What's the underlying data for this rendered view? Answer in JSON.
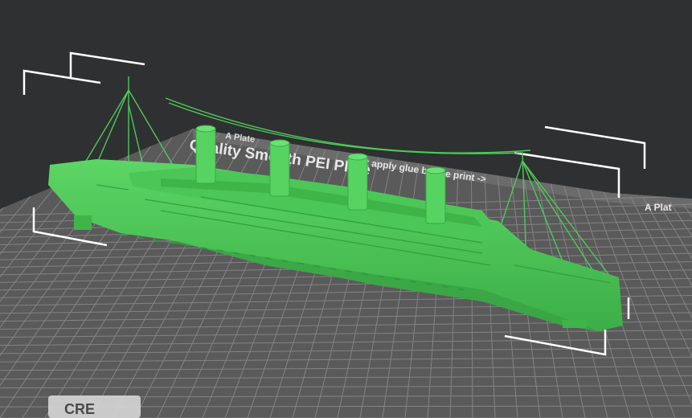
{
  "viewport": {
    "background": "#2f3031",
    "model_color": "#4fc95a",
    "model_name": "Titanic"
  },
  "build_plate": {
    "tab_left": "A Plate",
    "tab_right": "A Plat",
    "notice": "Quality Smooth PEI Plate",
    "notice_tail": "st apply glue before print ->",
    "brand": "CRE",
    "grid_color": "#8b8b8b",
    "plate_color": "#5a5a5b"
  },
  "icons": {
    "selection_brackets": "bounding-box-corner-icon",
    "grid": "print-bed-grid"
  }
}
